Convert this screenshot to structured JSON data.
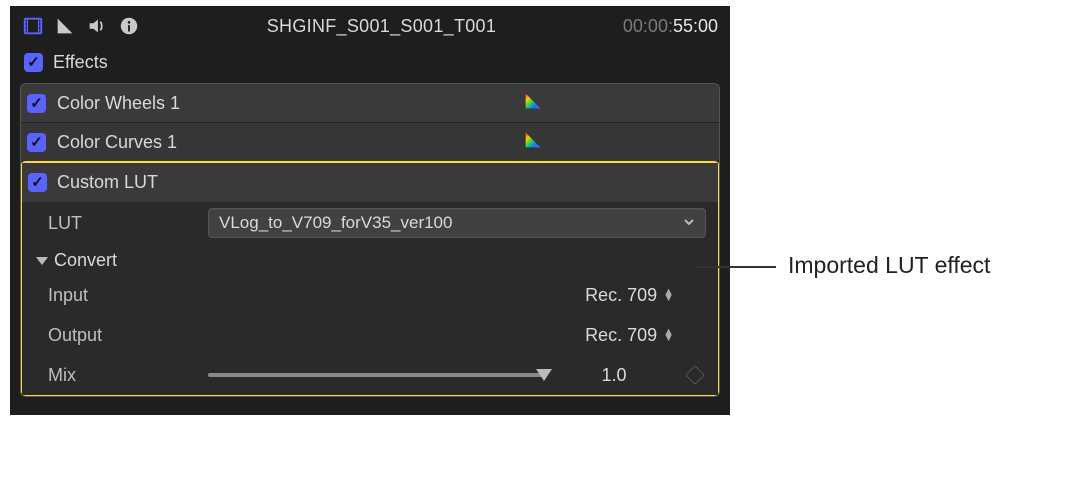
{
  "header": {
    "clip_name": "SHGINF_S001_S001_T001",
    "timecode_dim": "00:00:",
    "timecode_active": "55:00"
  },
  "effects_section_label": "Effects",
  "effects": [
    {
      "name": "Color Wheels 1",
      "has_swatch": true
    },
    {
      "name": "Color Curves 1",
      "has_swatch": true
    }
  ],
  "custom_lut": {
    "title": "Custom LUT",
    "lut_label": "LUT",
    "lut_selected": "VLog_to_V709_forV35_ver100",
    "convert_label": "Convert",
    "input_label": "Input",
    "input_value": "Rec. 709",
    "output_label": "Output",
    "output_value": "Rec. 709",
    "mix_label": "Mix",
    "mix_value": "1.0"
  },
  "callout": "Imported LUT effect"
}
